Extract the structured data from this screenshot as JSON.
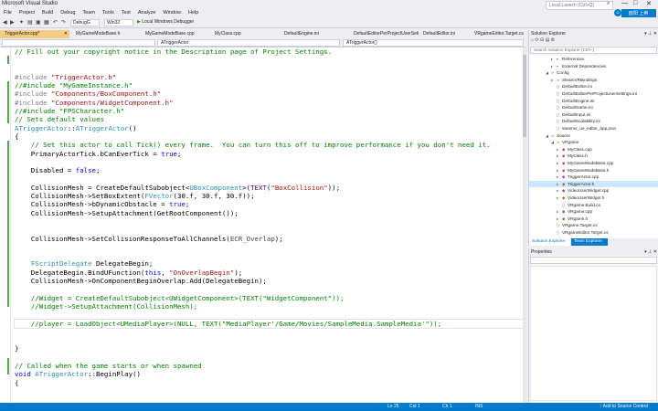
{
  "window": {
    "title": "Microsoft Visual Studio",
    "quick_launch_placeholder": "Local Launch (Ctrl+Q)",
    "min": "—",
    "max": "□",
    "close": "✕",
    "user_label": "欧阳 上帝"
  },
  "menu": [
    "File",
    "Project",
    "Build",
    "Debug",
    "Team",
    "Tools",
    "Test",
    "Analyze",
    "Window",
    "Help"
  ],
  "toolbar": {
    "config": "DebugG",
    "platform": "Win32",
    "run_label": "Local Windows Debugger"
  },
  "doc_tabs": [
    {
      "label": "TriggerActor.cpp*",
      "active": true
    },
    {
      "label": "MyGameModeBase.h",
      "active": false
    },
    {
      "label": "MyGameModeBase.cpp",
      "active": false
    },
    {
      "label": "MyClass.cpp",
      "active": false
    },
    {
      "label": "DefaultEngine.ini",
      "active": false
    },
    {
      "label": "DefaultEditorPerProjectUserSettings.ini",
      "active": false
    },
    {
      "label": "DefaultEditor.ini",
      "active": false
    },
    {
      "label": "VRgameEditor.Target.cs",
      "active": false
    }
  ],
  "nav": {
    "left": "",
    "middle": "ATriggerActor",
    "right": "ATriggerActor()"
  },
  "code_lines": [
    [
      [
        "c-comment",
        "// Fill out your copyright notice in the Description page of Project Settings."
      ]
    ],
    [],
    [],
    [
      [
        "c-pre",
        "#include "
      ],
      [
        "c-string",
        "\"TriggerActor.h\""
      ]
    ],
    [
      [
        "c-comment",
        "//#include \"MyGameInstance.h\""
      ]
    ],
    [
      [
        "c-pre",
        "#include "
      ],
      [
        "c-string",
        "\"Components/BoxComponent.h\""
      ]
    ],
    [
      [
        "c-pre",
        "#include "
      ],
      [
        "c-string",
        "\"Components/WidgetComponent.h\""
      ]
    ],
    [
      [
        "c-comment",
        "//#include \"FPSCharacter.h\""
      ]
    ],
    [
      [
        "c-comment",
        "// Sets default values"
      ]
    ],
    [
      [
        "c-type",
        "ATriggerActor"
      ],
      [
        "c-plain",
        "::"
      ],
      [
        "c-type",
        "ATriggerActor"
      ],
      [
        "c-plain",
        "()"
      ]
    ],
    [
      [
        "c-plain",
        "{"
      ]
    ],
    [
      [
        "c-comment",
        "    // Set this actor to call Tick() every frame.  You can turn this off to improve performance if you don't need it."
      ]
    ],
    [
      [
        "c-plain",
        "    PrimaryActorTick.bCanEverTick = "
      ],
      [
        "c-keyword",
        "true"
      ],
      [
        "c-plain",
        ";"
      ]
    ],
    [],
    [
      [
        "c-plain",
        "    Disabled = "
      ],
      [
        "c-keyword",
        "false"
      ],
      [
        "c-plain",
        ";"
      ]
    ],
    [],
    [
      [
        "c-plain",
        "    CollisionMesh = CreateDefaultSubobject<"
      ],
      [
        "c-type",
        "UBoxComponent"
      ],
      [
        "c-plain",
        ">("
      ],
      [
        "c-macro",
        "TEXT"
      ],
      [
        "c-plain",
        "("
      ],
      [
        "c-string",
        "\"BoxCollision\""
      ],
      [
        "c-plain",
        "));"
      ]
    ],
    [
      [
        "c-plain",
        "    CollisionMesh->SetBoxExtent("
      ],
      [
        "c-type",
        "FVector"
      ],
      [
        "c-plain",
        "(30.f, 30.f, 30.f));"
      ]
    ],
    [
      [
        "c-plain",
        "    CollisionMesh->bDynamicObstacle = "
      ],
      [
        "c-keyword",
        "true"
      ],
      [
        "c-plain",
        ";"
      ]
    ],
    [
      [
        "c-plain",
        "    CollisionMesh->SetupAttachment(GetRootComponent());"
      ]
    ],
    [],
    [],
    [
      [
        "c-plain",
        "    CollisionMesh->SetCollisionResponseToAllChannels("
      ],
      [
        "c-enum",
        "ECR_Overlap"
      ],
      [
        "c-plain",
        ");"
      ]
    ],
    [],
    [],
    [
      [
        "c-plain",
        "    "
      ],
      [
        "c-type",
        "FScriptDelegate"
      ],
      [
        "c-plain",
        " DelegateBegin;"
      ]
    ],
    [
      [
        "c-plain",
        "    DelegateBegin.BindUFunction("
      ],
      [
        "c-keyword",
        "this"
      ],
      [
        "c-plain",
        ", "
      ],
      [
        "c-string",
        "\"OnOverlapBegin\""
      ],
      [
        "c-plain",
        ");"
      ]
    ],
    [
      [
        "c-plain",
        "    CollisionMesh->OnComponentBeginOverlap.Add(DelegateBegin);"
      ]
    ],
    [],
    [
      [
        "c-comment",
        "    //Widget = CreateDefaultSubobject<UWidgetComponent>(TEXT(\"WidgetComponent\"));"
      ]
    ],
    [
      [
        "c-comment",
        "    //Widget->SetupAttachment(CollisionMesh);"
      ]
    ],
    [],
    [
      [
        "c-comment",
        "    //player = LoadObject<UMediaPlayer>(NULL, TEXT(\"MediaPlayer'/Game/Movies/SampleMedia.SampleMedia'\"));"
      ]
    ],
    [],
    [],
    [
      [
        "c-plain",
        "}"
      ]
    ],
    [],
    [
      [
        "c-comment",
        "// Called when the game starts or when spawned"
      ]
    ],
    [
      [
        "c-keyword",
        "void"
      ],
      [
        "c-plain",
        " "
      ],
      [
        "c-type",
        "ATriggerActor"
      ],
      [
        "c-plain",
        "::BeginPlay()"
      ]
    ],
    [
      [
        "c-plain",
        "{"
      ]
    ]
  ],
  "status": {
    "line": "Ln 25",
    "col": "Col 1",
    "ch": "Ch 1",
    "mode": "INS",
    "source_control": "Add to Source Control"
  },
  "solution_explorer": {
    "title": "Solution Explorer",
    "search_placeholder": "Search Solution Explorer (Ctrl+;)",
    "tree": [
      {
        "indent": 4,
        "arrow": "▸",
        "icon": "ref",
        "label": "References",
        "selected": false
      },
      {
        "indent": 4,
        "arrow": "▸",
        "icon": "ref",
        "label": "External Dependencies",
        "selected": false
      },
      {
        "indent": 3,
        "arrow": "◢",
        "icon": "folder",
        "label": "Config",
        "selected": false
      },
      {
        "indent": 4,
        "arrow": "▸",
        "icon": "folder",
        "label": "SteamVRBindings",
        "selected": false
      },
      {
        "indent": 4,
        "arrow": "",
        "icon": "file",
        "label": "DefaultEditor.ini",
        "selected": false
      },
      {
        "indent": 4,
        "arrow": "",
        "icon": "file",
        "label": "DefaultEditorPerProjectUserSettings.ini",
        "selected": false
      },
      {
        "indent": 4,
        "arrow": "",
        "icon": "file",
        "label": "DefaultEngine.ini",
        "selected": false
      },
      {
        "indent": 4,
        "arrow": "",
        "icon": "file",
        "label": "DefaultGame.ini",
        "selected": false
      },
      {
        "indent": 4,
        "arrow": "",
        "icon": "file",
        "label": "DefaultInput.ini",
        "selected": false
      },
      {
        "indent": 4,
        "arrow": "",
        "icon": "file",
        "label": "DefaultScalability.ini",
        "selected": false
      },
      {
        "indent": 4,
        "arrow": "",
        "icon": "file",
        "label": "steamvr_ue_editor_app.json",
        "selected": false
      },
      {
        "indent": 3,
        "arrow": "◢",
        "icon": "folder",
        "label": "Source",
        "selected": false
      },
      {
        "indent": 4,
        "arrow": "◢",
        "icon": "folder",
        "label": "VRgame",
        "selected": false
      },
      {
        "indent": 5,
        "arrow": "▸",
        "icon": "cpp",
        "label": "MyClass.cpp",
        "selected": false
      },
      {
        "indent": 5,
        "arrow": "▸",
        "icon": "h",
        "label": "MyClass.h",
        "selected": false
      },
      {
        "indent": 5,
        "arrow": "▸",
        "icon": "cpp",
        "label": "MyGameModeBase.cpp",
        "selected": false
      },
      {
        "indent": 5,
        "arrow": "▸",
        "icon": "h",
        "label": "MyGameModeBase.h",
        "selected": false
      },
      {
        "indent": 5,
        "arrow": "▸",
        "icon": "cpp",
        "label": "TriggerActor.cpp",
        "selected": false
      },
      {
        "indent": 5,
        "arrow": "▸",
        "icon": "h",
        "label": "TriggerActor.h",
        "selected": true
      },
      {
        "indent": 5,
        "arrow": "▸",
        "icon": "cpp",
        "label": "VideoUserWidget.cpp",
        "selected": false
      },
      {
        "indent": 5,
        "arrow": "▸",
        "icon": "h",
        "label": "VideoUserWidget.h",
        "selected": false
      },
      {
        "indent": 5,
        "arrow": "",
        "icon": "file",
        "label": "VRgame.Build.cs",
        "selected": false
      },
      {
        "indent": 5,
        "arrow": "▸",
        "icon": "cpp",
        "label": "VRgame.cpp",
        "selected": false
      },
      {
        "indent": 5,
        "arrow": "▸",
        "icon": "h",
        "label": "VRgame.h",
        "selected": false
      },
      {
        "indent": 4,
        "arrow": "",
        "icon": "file",
        "label": "VRgame.Target.cs",
        "selected": false
      },
      {
        "indent": 4,
        "arrow": "",
        "icon": "file",
        "label": "VRgameEditor.Target.cs",
        "selected": false
      }
    ],
    "tabs": [
      {
        "label": "Solution Explorer",
        "active": true
      },
      {
        "label": "Team Explorer",
        "active": false
      }
    ]
  },
  "properties": {
    "title": "Properties"
  }
}
